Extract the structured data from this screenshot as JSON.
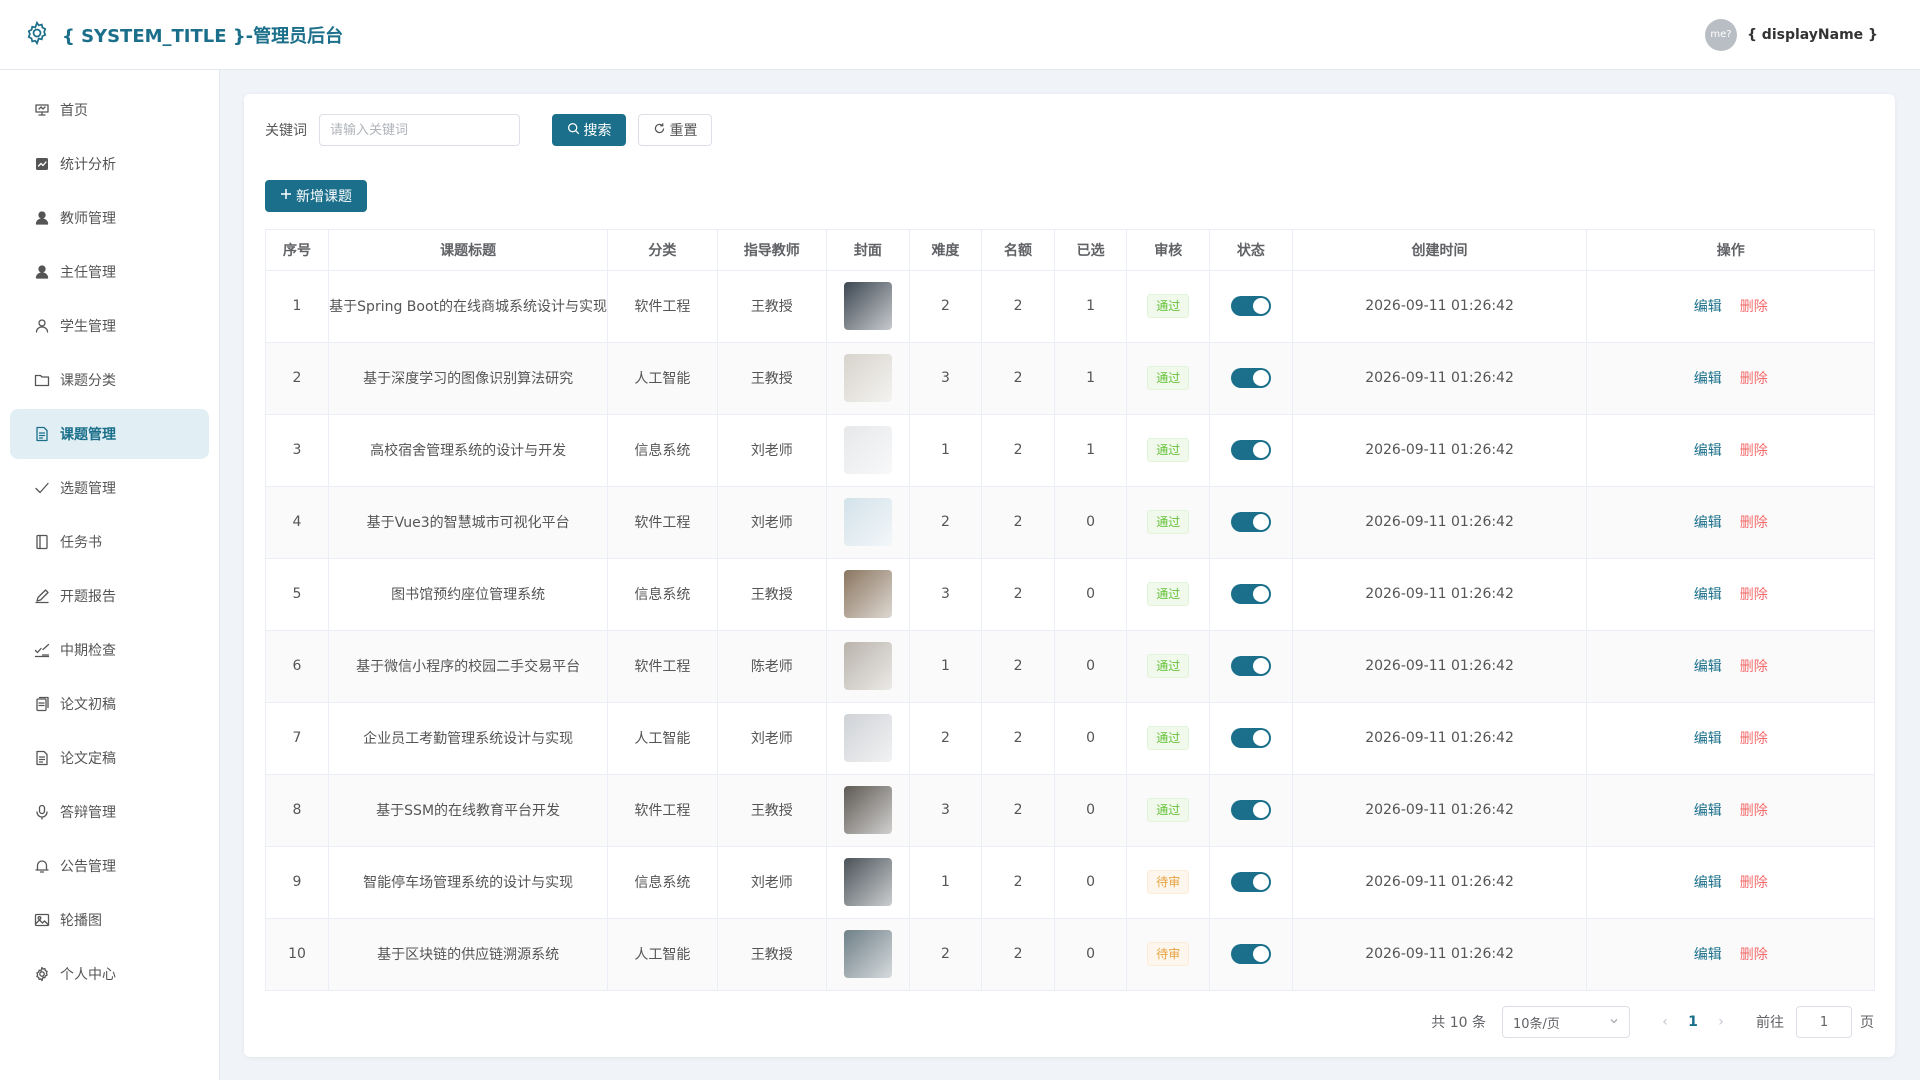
{
  "header": {
    "title": "{ SYSTEM_TITLE }-管理员后台",
    "avatar_text": "me?",
    "user_name": "{ displayName }"
  },
  "sidebar": {
    "items": [
      {
        "label": "首页",
        "icon": "home-icon"
      },
      {
        "label": "统计分析",
        "icon": "chart-icon"
      },
      {
        "label": "教师管理",
        "icon": "user-icon"
      },
      {
        "label": "主任管理",
        "icon": "user-icon"
      },
      {
        "label": "学生管理",
        "icon": "user-outline-icon"
      },
      {
        "label": "课题分类",
        "icon": "folder-icon"
      },
      {
        "label": "课题管理",
        "icon": "document-icon",
        "active": true
      },
      {
        "label": "选题管理",
        "icon": "check-icon"
      },
      {
        "label": "任务书",
        "icon": "notebook-icon"
      },
      {
        "label": "开题报告",
        "icon": "edit-pen-icon"
      },
      {
        "label": "中期检查",
        "icon": "checklist-icon"
      },
      {
        "label": "论文初稿",
        "icon": "copy-doc-icon"
      },
      {
        "label": "论文定稿",
        "icon": "document-icon"
      },
      {
        "label": "答辩管理",
        "icon": "microphone-icon"
      },
      {
        "label": "公告管理",
        "icon": "bell-icon"
      },
      {
        "label": "轮播图",
        "icon": "picture-icon"
      },
      {
        "label": "个人中心",
        "icon": "gear-icon"
      }
    ]
  },
  "search": {
    "label": "关键词",
    "placeholder": "请输入关键词",
    "value": "",
    "search_button": "搜索",
    "reset_button": "重置",
    "add_button": "新增课题"
  },
  "table": {
    "headers": [
      "序号",
      "课题标题",
      "分类",
      "指导教师",
      "封面",
      "难度",
      "名额",
      "已选",
      "审核",
      "状态",
      "创建时间",
      "操作"
    ],
    "edit_label": "编辑",
    "delete_label": "删除",
    "rows": [
      {
        "no": "1",
        "title": "基于Spring Boot的在线商城系统设计与实现",
        "category": "软件工程",
        "teacher": "王教授",
        "difficulty": "2",
        "quota": "2",
        "selected": "1",
        "review": "通过",
        "review_status": "pass",
        "enabled": true,
        "created": "2026-09-11 01:26:42",
        "cover_color": "#3d4752"
      },
      {
        "no": "2",
        "title": "基于深度学习的图像识别算法研究",
        "category": "人工智能",
        "teacher": "王教授",
        "difficulty": "3",
        "quota": "2",
        "selected": "1",
        "review": "通过",
        "review_status": "pass",
        "enabled": true,
        "created": "2026-09-11 01:26:42",
        "cover_color": "#d7d3cc"
      },
      {
        "no": "3",
        "title": "高校宿舍管理系统的设计与开发",
        "category": "信息系统",
        "teacher": "刘老师",
        "difficulty": "1",
        "quota": "2",
        "selected": "1",
        "review": "通过",
        "review_status": "pass",
        "enabled": true,
        "created": "2026-09-11 01:26:42",
        "cover_color": "#e6e8ea"
      },
      {
        "no": "4",
        "title": "基于Vue3的智慧城市可视化平台",
        "category": "软件工程",
        "teacher": "刘老师",
        "difficulty": "2",
        "quota": "2",
        "selected": "0",
        "review": "通过",
        "review_status": "pass",
        "enabled": true,
        "created": "2026-09-11 01:26:42",
        "cover_color": "#d3e2ea"
      },
      {
        "no": "5",
        "title": "图书馆预约座位管理系统",
        "category": "信息系统",
        "teacher": "王教授",
        "difficulty": "3",
        "quota": "2",
        "selected": "0",
        "review": "通过",
        "review_status": "pass",
        "enabled": true,
        "created": "2026-09-11 01:26:42",
        "cover_color": "#8a7660"
      },
      {
        "no": "6",
        "title": "基于微信小程序的校园二手交易平台",
        "category": "软件工程",
        "teacher": "陈老师",
        "difficulty": "1",
        "quota": "2",
        "selected": "0",
        "review": "通过",
        "review_status": "pass",
        "enabled": true,
        "created": "2026-09-11 01:26:42",
        "cover_color": "#b9b3ab"
      },
      {
        "no": "7",
        "title": "企业员工考勤管理系统设计与实现",
        "category": "人工智能",
        "teacher": "刘老师",
        "difficulty": "2",
        "quota": "2",
        "selected": "0",
        "review": "通过",
        "review_status": "pass",
        "enabled": true,
        "created": "2026-09-11 01:26:42",
        "cover_color": "#cfd2d6"
      },
      {
        "no": "8",
        "title": "基于SSM的在线教育平台开发",
        "category": "软件工程",
        "teacher": "王教授",
        "difficulty": "3",
        "quota": "2",
        "selected": "0",
        "review": "通过",
        "review_status": "pass",
        "enabled": true,
        "created": "2026-09-11 01:26:42",
        "cover_color": "#5e5a55"
      },
      {
        "no": "9",
        "title": "智能停车场管理系统的设计与实现",
        "category": "信息系统",
        "teacher": "刘老师",
        "difficulty": "1",
        "quota": "2",
        "selected": "0",
        "review": "待审",
        "review_status": "wait",
        "enabled": true,
        "created": "2026-09-11 01:26:42",
        "cover_color": "#4b5359"
      },
      {
        "no": "10",
        "title": "基于区块链的供应链溯源系统",
        "category": "人工智能",
        "teacher": "王教授",
        "difficulty": "2",
        "quota": "2",
        "selected": "0",
        "review": "待审",
        "review_status": "wait",
        "enabled": true,
        "created": "2026-09-11 01:26:42",
        "cover_color": "#6f8088"
      }
    ]
  },
  "pagination": {
    "total_text": "共 10 条",
    "page_size": "10条/页",
    "current_page": "1",
    "goto_label": "前往",
    "goto_value": "1",
    "page_suffix": "页"
  },
  "colors": {
    "primary": "#1b6f8a",
    "danger": "#f56c6c",
    "success": "#67c23a",
    "warning": "#e6a23c"
  }
}
